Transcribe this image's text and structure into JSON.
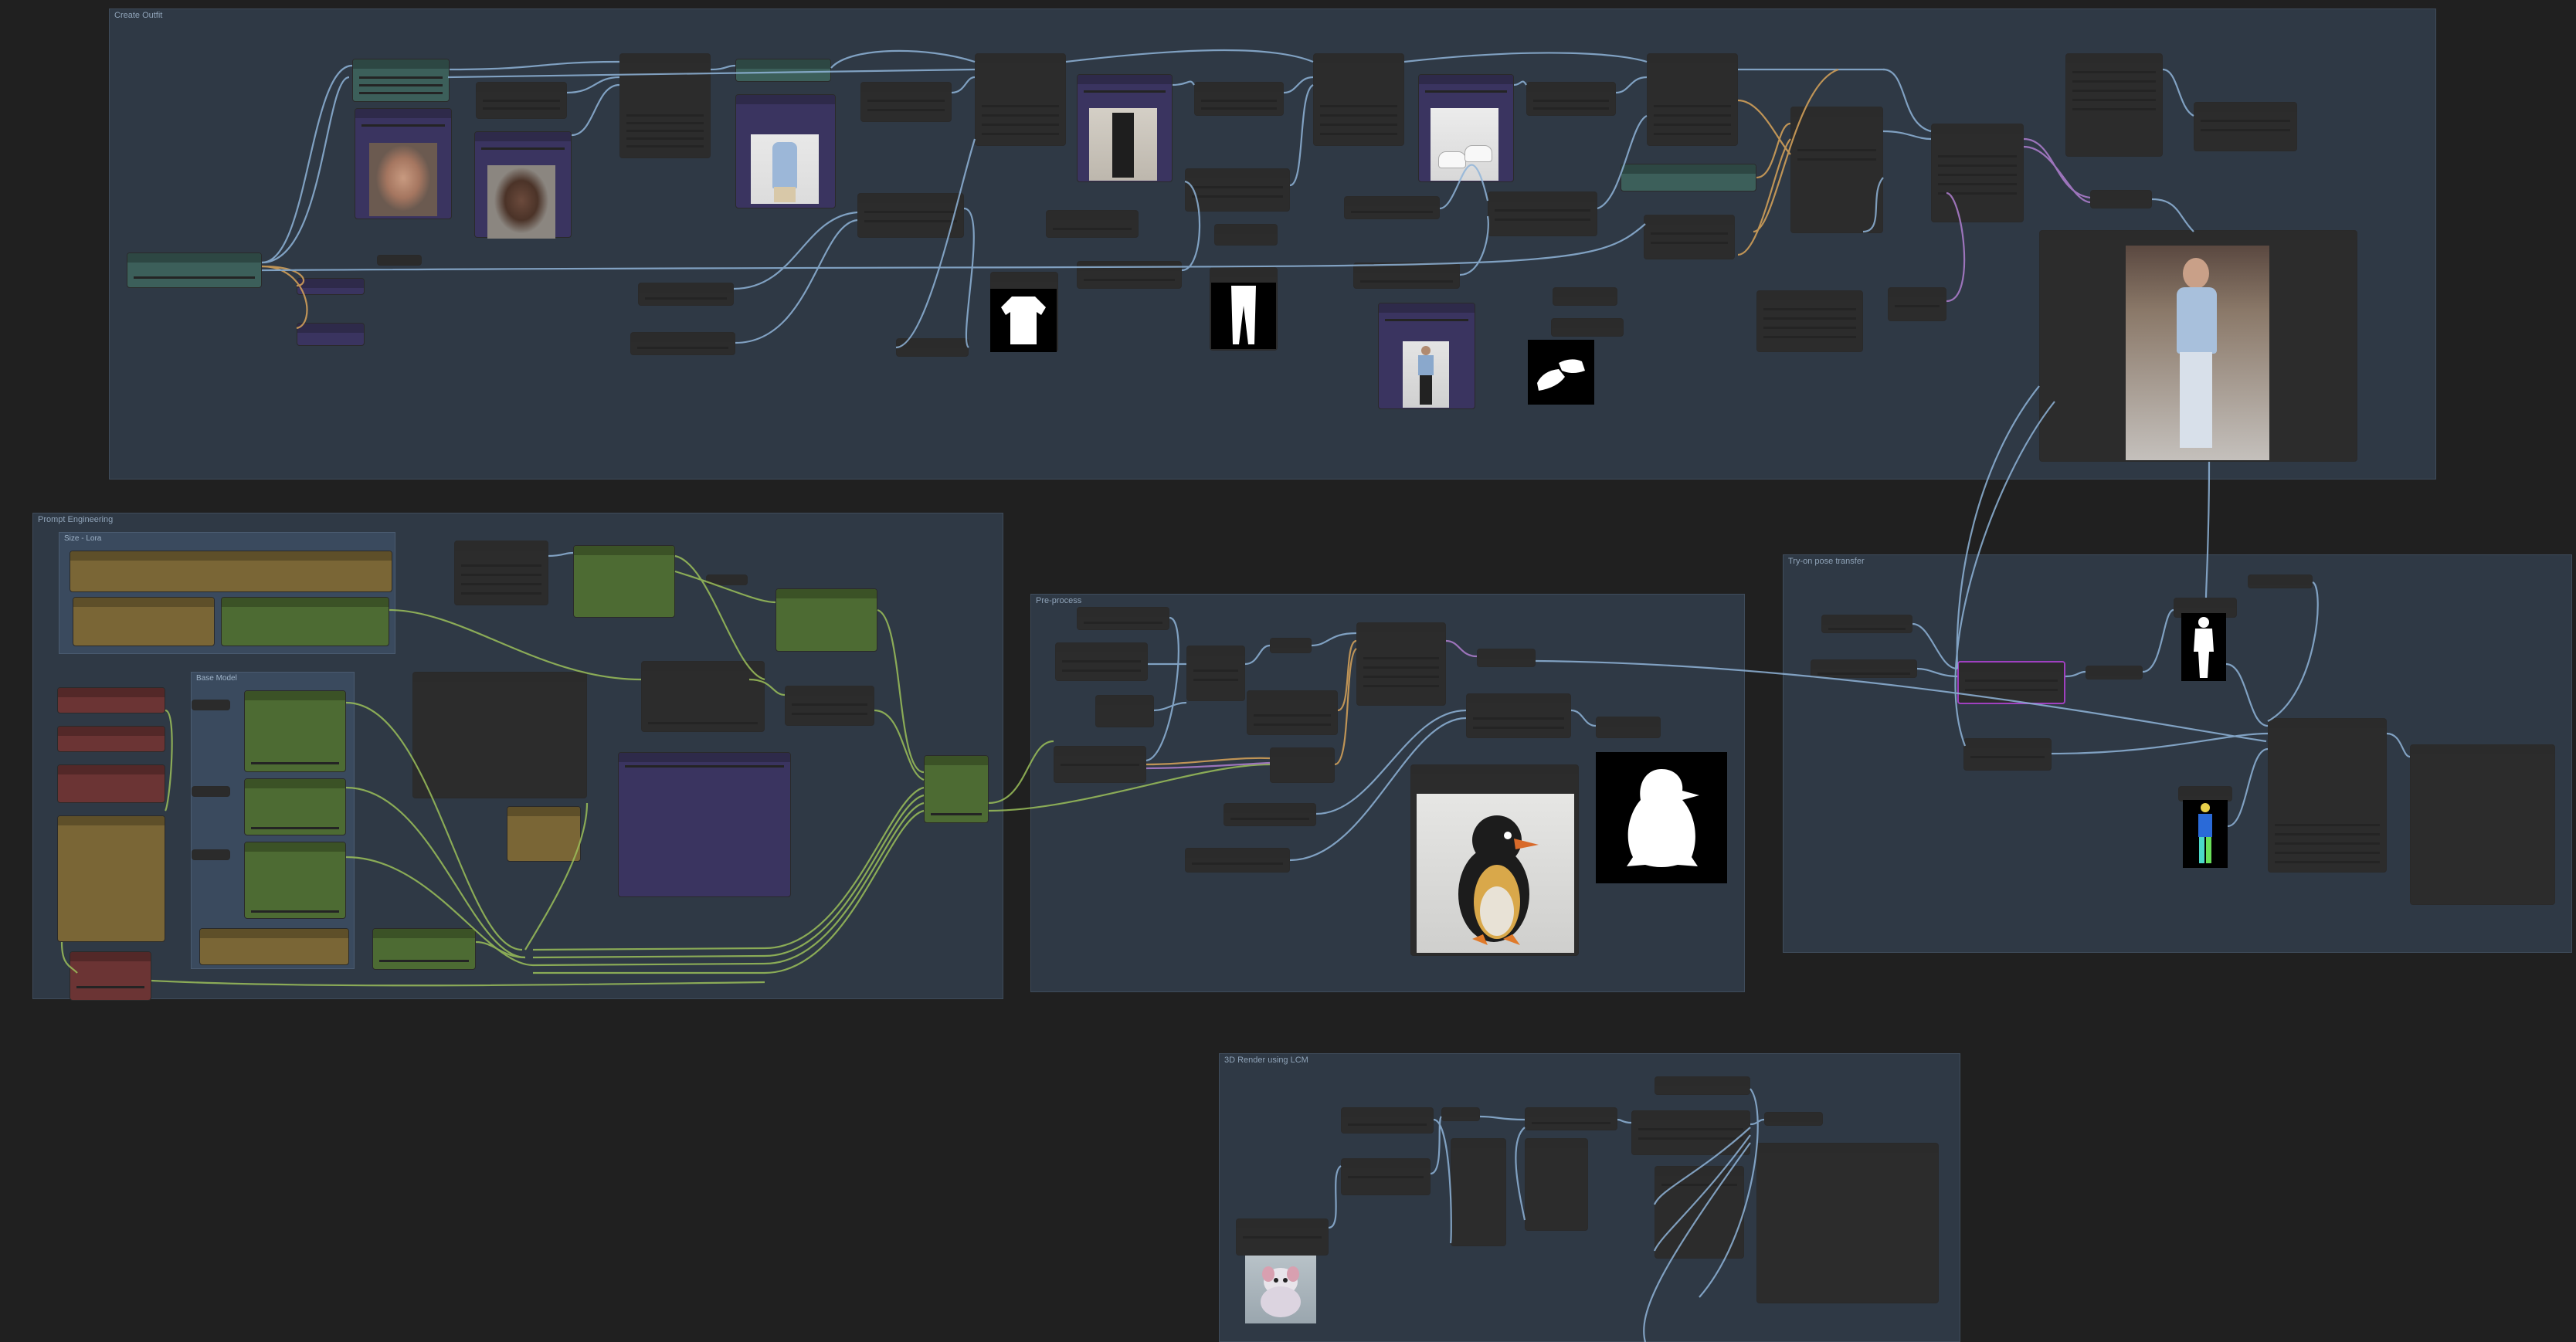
{
  "groups": {
    "top": "Create Outfit",
    "left": "Prompt Engineering",
    "sub_lora": "Size - Lora",
    "sub_model": "Base Model",
    "mid": "Pre-process",
    "right": "Try-on pose transfer",
    "bottom": "3D Render using LCM"
  },
  "icons": {
    "face1": "male-face-photo-icon",
    "face2": "male-face-photo-icon",
    "shirt": "blue-shirt-photo-icon",
    "pants": "black-pants-photo-icon",
    "shoes": "white-sneakers-photo-icon",
    "model": "full-body-model-photo-icon",
    "penguin": "penguin-render-icon",
    "figure": "3d-figure-render-icon",
    "mask_shirt": "shirt-mask-icon",
    "mask_pants": "pants-mask-icon",
    "mask_shoes": "shoes-mask-icon",
    "mask_penguin": "penguin-mask-icon",
    "mask_person": "person-mask-icon",
    "pose": "pose-map-icon",
    "result": "generated-outfit-photo-icon"
  },
  "colors": {
    "canvas": "#202020",
    "group": "#2f3945",
    "node": "#353535",
    "link_blue": "#8fb4d8",
    "link_green": "#9bbf5a",
    "link_orange": "#d9a45a",
    "link_purple": "#b07fd0"
  }
}
